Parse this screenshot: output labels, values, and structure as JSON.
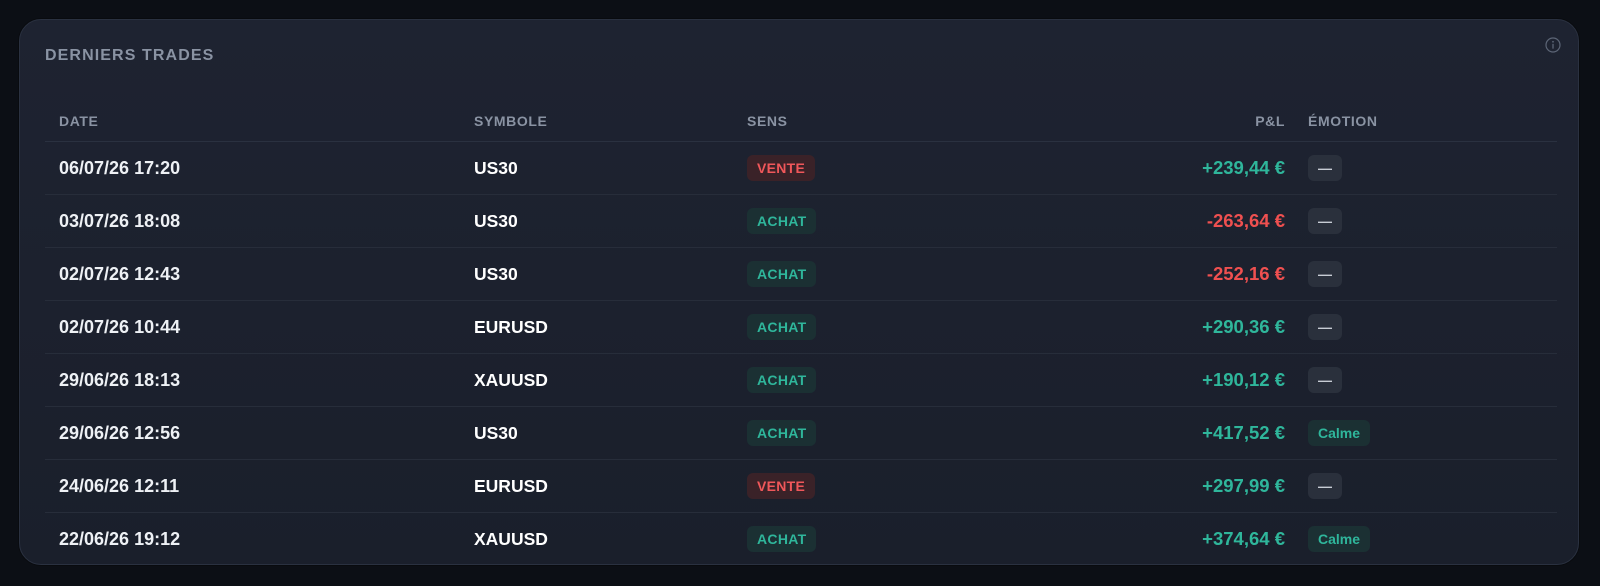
{
  "card": {
    "title": "DERNIERS TRADES"
  },
  "table": {
    "headers": {
      "date": "DATE",
      "symbol": "SYMBOLE",
      "side": "SENS",
      "pnl": "P&L",
      "emotion": "ÉMOTION"
    },
    "rows": [
      {
        "date": "06/07/26 17:20",
        "symbol": "US30",
        "side": "VENTE",
        "side_type": "sell",
        "pnl": "+239,44 €",
        "pnl_sign": "pos",
        "emotion": "—",
        "emotion_type": "none"
      },
      {
        "date": "03/07/26 18:08",
        "symbol": "US30",
        "side": "ACHAT",
        "side_type": "buy",
        "pnl": "-263,64 €",
        "pnl_sign": "neg",
        "emotion": "—",
        "emotion_type": "none"
      },
      {
        "date": "02/07/26 12:43",
        "symbol": "US30",
        "side": "ACHAT",
        "side_type": "buy",
        "pnl": "-252,16 €",
        "pnl_sign": "neg",
        "emotion": "—",
        "emotion_type": "none"
      },
      {
        "date": "02/07/26 10:44",
        "symbol": "EURUSD",
        "side": "ACHAT",
        "side_type": "buy",
        "pnl": "+290,36 €",
        "pnl_sign": "pos",
        "emotion": "—",
        "emotion_type": "none"
      },
      {
        "date": "29/06/26 18:13",
        "symbol": "XAUUSD",
        "side": "ACHAT",
        "side_type": "buy",
        "pnl": "+190,12 €",
        "pnl_sign": "pos",
        "emotion": "—",
        "emotion_type": "none"
      },
      {
        "date": "29/06/26 12:56",
        "symbol": "US30",
        "side": "ACHAT",
        "side_type": "buy",
        "pnl": "+417,52 €",
        "pnl_sign": "pos",
        "emotion": "Calme",
        "emotion_type": "calm"
      },
      {
        "date": "24/06/26 12:11",
        "symbol": "EURUSD",
        "side": "VENTE",
        "side_type": "sell",
        "pnl": "+297,99 €",
        "pnl_sign": "pos",
        "emotion": "—",
        "emotion_type": "none"
      },
      {
        "date": "22/06/26 19:12",
        "symbol": "XAUUSD",
        "side": "ACHAT",
        "side_type": "buy",
        "pnl": "+374,64 €",
        "pnl_sign": "pos",
        "emotion": "Calme",
        "emotion_type": "calm"
      }
    ]
  },
  "colors": {
    "positive": "#2fb69b",
    "negative": "#ef5050",
    "sell_badge_bg": "#3a2228",
    "buy_badge_bg": "#1b3033"
  },
  "icons": {
    "info": "info-icon"
  }
}
